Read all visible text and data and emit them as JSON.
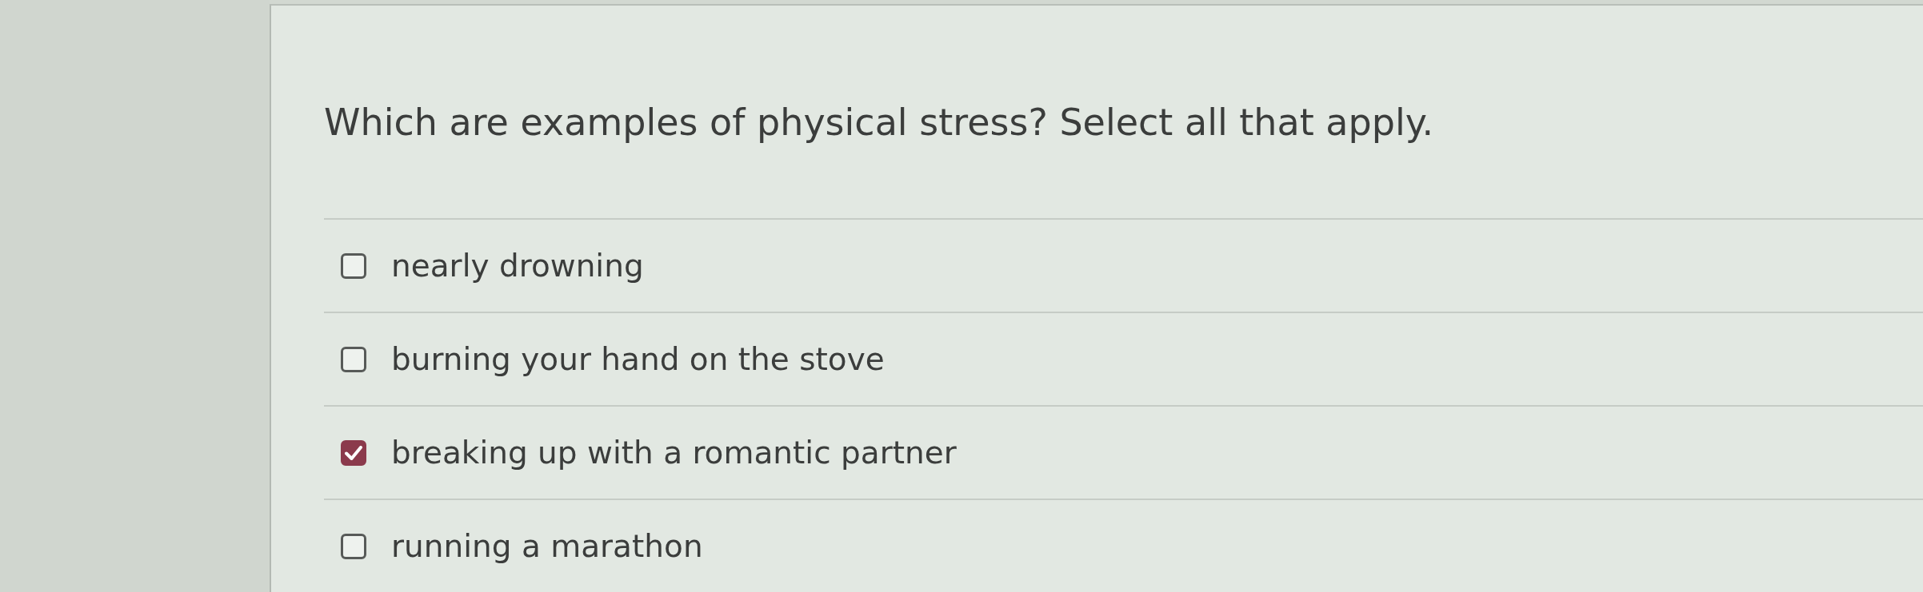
{
  "question": {
    "text": "Which are examples of physical stress? Select all that apply."
  },
  "options": [
    {
      "label": "nearly drowning",
      "checked": false
    },
    {
      "label": "burning your hand on the stove",
      "checked": false
    },
    {
      "label": "breaking up with a romantic partner",
      "checked": true
    },
    {
      "label": "running a marathon",
      "checked": false
    }
  ]
}
